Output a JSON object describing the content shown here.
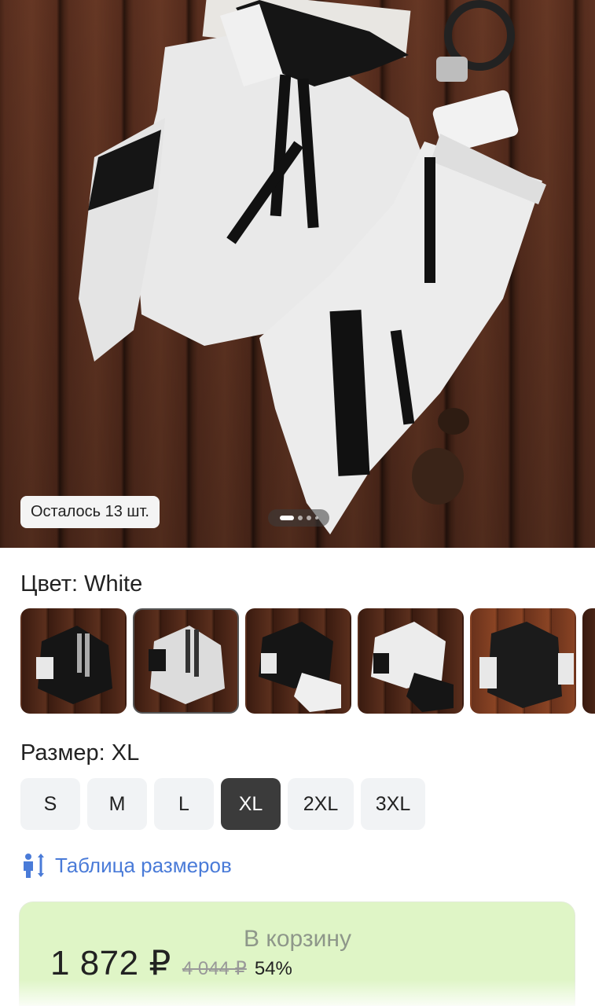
{
  "hero": {
    "stock_badge": "Осталось 13 шт.",
    "slide_dots": 4,
    "active_slide": 1
  },
  "color": {
    "label": "Цвет: White",
    "options": [
      "black-white",
      "white-black",
      "black-white-pants",
      "white-black-pants",
      "black-orange"
    ],
    "selected_index": 1
  },
  "size": {
    "label": "Размер: XL",
    "options": [
      "S",
      "M",
      "L",
      "XL",
      "2XL",
      "3XL"
    ],
    "selected": "XL"
  },
  "size_table": {
    "label": "Таблица размеров",
    "icon": "person-height-icon"
  },
  "cart": {
    "button_label": "В корзину",
    "price": "1 872 ₽",
    "old_price": "4 044 ₽",
    "discount": "54%"
  },
  "colors": {
    "link": "#4a7bd8",
    "cart_bg": "#dff5c6",
    "selected_size_bg": "#3b3b3b"
  }
}
